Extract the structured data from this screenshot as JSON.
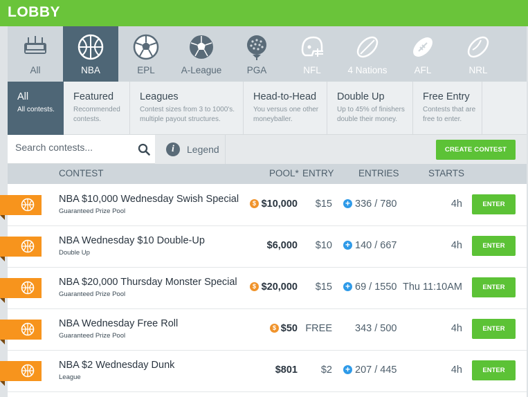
{
  "header": {
    "title": "LOBBY"
  },
  "sports": [
    {
      "label": "All",
      "icon": "stadium-icon",
      "state": "normal"
    },
    {
      "label": "NBA",
      "icon": "basketball-icon",
      "state": "active"
    },
    {
      "label": "EPL",
      "icon": "soccer-ball-icon",
      "state": "normal"
    },
    {
      "label": "A-League",
      "icon": "soccer-ball-icon",
      "state": "normal"
    },
    {
      "label": "PGA",
      "icon": "golf-ball-icon",
      "state": "normal"
    },
    {
      "label": "NFL",
      "icon": "football-helmet-icon",
      "state": "disabled"
    },
    {
      "label": "4 Nations",
      "icon": "rugby-ball-icon",
      "state": "disabled"
    },
    {
      "label": "AFL",
      "icon": "afl-ball-icon",
      "state": "disabled"
    },
    {
      "label": "NRL",
      "icon": "rugby-ball-icon",
      "state": "disabled"
    }
  ],
  "contest_types": [
    {
      "title": "All",
      "desc": "All contests.",
      "active": true
    },
    {
      "title": "Featured",
      "desc": "Recommended contests."
    },
    {
      "title": "Leagues",
      "desc": "Contest sizes from 3 to 1000's. multiple payout structures."
    },
    {
      "title": "Head-to-Head",
      "desc": "You versus one other moneyballer."
    },
    {
      "title": "Double Up",
      "desc": "Up to 45% of finishers double their money."
    },
    {
      "title": "Free Entry",
      "desc": "Contests that are free to enter."
    }
  ],
  "toolbar": {
    "search_placeholder": "Search contests...",
    "legend_label": "Legend",
    "create_label": "CREATE CONTEST"
  },
  "table": {
    "headers": {
      "contest": "CONTEST",
      "pool": "POOL*",
      "entry": "ENTRY",
      "entries": "ENTRIES",
      "starts": "STARTS"
    },
    "rows": [
      {
        "name": "NBA $10,000 Wednesday Swish Special",
        "type": "Guaranteed Prize Pool",
        "pool": "$10,000",
        "coin": true,
        "entry": "$15",
        "plus": true,
        "entries": "336 / 780",
        "starts": "4h",
        "enter": "ENTER"
      },
      {
        "name": "NBA Wednesday $10 Double-Up",
        "type": "Double Up",
        "pool": "$6,000",
        "coin": false,
        "entry": "$10",
        "plus": true,
        "entries": "140 / 667",
        "starts": "4h",
        "enter": "ENTER"
      },
      {
        "name": "NBA $20,000 Thursday Monster Special",
        "type": "Guaranteed Prize Pool",
        "pool": "$20,000",
        "coin": true,
        "entry": "$15",
        "plus": true,
        "entries": "69 / 1550",
        "starts": "Thu 11:10AM",
        "enter": "ENTER"
      },
      {
        "name": "NBA Wednesday Free Roll",
        "type": "Guaranteed Prize Pool",
        "pool": "$50",
        "coin": true,
        "entry": "FREE",
        "plus": false,
        "entries": "343 / 500",
        "starts": "4h",
        "enter": "ENTER"
      },
      {
        "name": "NBA $2 Wednesday Dunk",
        "type": "League",
        "pool": "$801",
        "coin": false,
        "entry": "$2",
        "plus": true,
        "entries": "207 / 445",
        "starts": "4h",
        "enter": "ENTER"
      }
    ],
    "coin_symbol": "$",
    "plus_symbol": "+"
  },
  "colors": {
    "brand_green": "#6ac43a",
    "button_green": "#5cc236",
    "active_slate": "#4e6676",
    "ribbon_orange": "#f7941d",
    "coin_orange": "#f0932b",
    "plus_blue": "#2e9ae8"
  }
}
